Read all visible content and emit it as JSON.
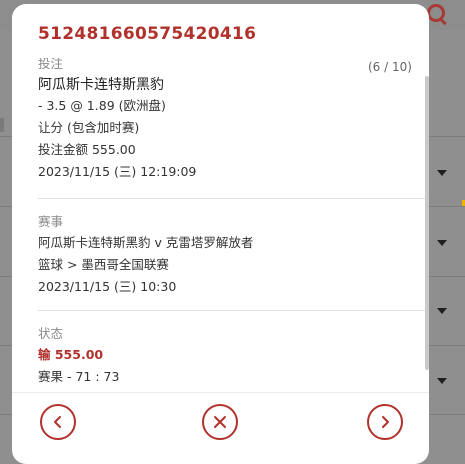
{
  "modal": {
    "title": "512481660575420416",
    "bet": {
      "label": "投注",
      "counter": "(6 / 10)",
      "selection": "阿瓜斯卡连特斯黑豹",
      "odds_line": "- 3.5 @ 1.89 (欧洲盘)",
      "market": "让分 (包含加时赛)",
      "stake": "投注金额 555.00",
      "placed_time": "2023/11/15 (三) 12:19:09"
    },
    "event": {
      "label": "赛事",
      "match": "阿瓜斯卡连特斯黑豹 v 克雷塔罗解放者",
      "league": "篮球 > 墨西哥全国联赛",
      "start_time": "2023/11/15 (三) 10:30"
    },
    "status": {
      "label": "状态",
      "result": "输 555.00",
      "score": "赛果 - 71 : 73"
    },
    "footer": {
      "prev_icon": "chevron-left-icon",
      "close_icon": "close-icon",
      "next_icon": "chevron-right-icon"
    }
  },
  "colors": {
    "accent": "#b1322d",
    "overlay": "#8f8f8f",
    "label_gray": "#8a8a8a"
  }
}
